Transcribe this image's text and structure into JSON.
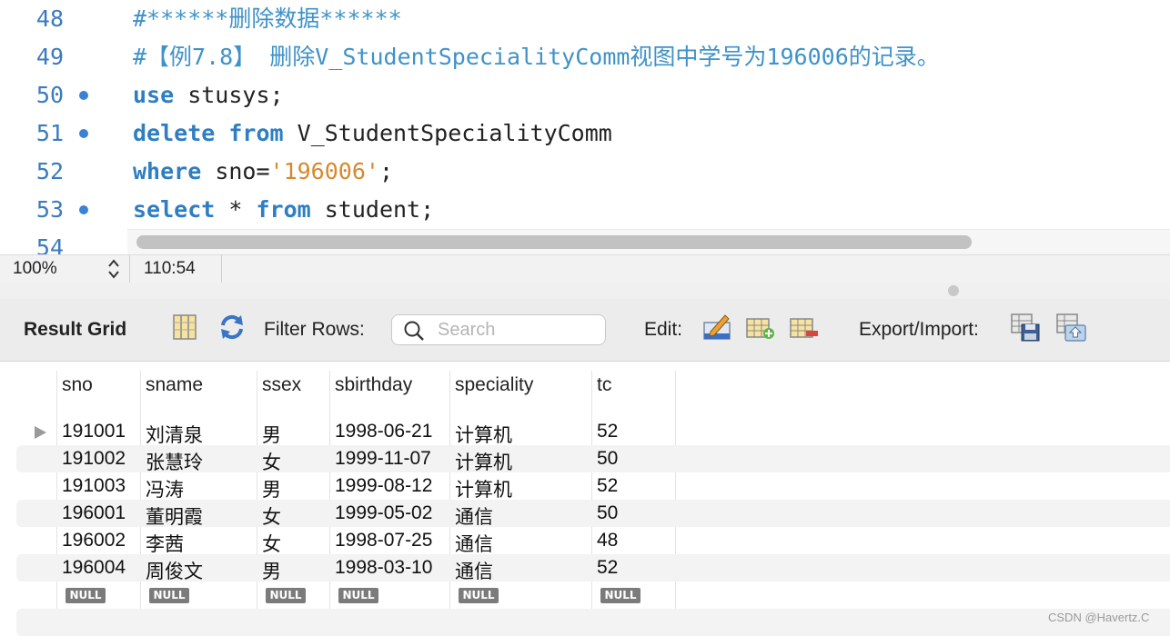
{
  "editor": {
    "lines": [
      {
        "num": "48",
        "dot": false,
        "parts": [
          {
            "t": "#******删除数据******",
            "c": "cm"
          }
        ]
      },
      {
        "num": "49",
        "dot": false,
        "parts": [
          {
            "t": "#【例7.8】 删除V_StudentSpecialityComm视图中学号为196006的记录。",
            "c": "cm"
          }
        ]
      },
      {
        "num": "50",
        "dot": true,
        "parts": [
          {
            "t": "use",
            "c": "kw"
          },
          {
            "t": " stusys;",
            "c": ""
          }
        ]
      },
      {
        "num": "51",
        "dot": true,
        "parts": [
          {
            "t": "delete",
            "c": "kw"
          },
          {
            "t": " ",
            "c": ""
          },
          {
            "t": "from",
            "c": "kw"
          },
          {
            "t": " V_StudentSpecialityComm",
            "c": ""
          }
        ]
      },
      {
        "num": "52",
        "dot": false,
        "parts": [
          {
            "t": "where",
            "c": "kw"
          },
          {
            "t": " sno=",
            "c": ""
          },
          {
            "t": "'196006'",
            "c": "str"
          },
          {
            "t": ";",
            "c": ""
          }
        ]
      },
      {
        "num": "53",
        "dot": true,
        "parts": [
          {
            "t": "select",
            "c": "kw"
          },
          {
            "t": " * ",
            "c": ""
          },
          {
            "t": "from",
            "c": "kw"
          },
          {
            "t": " student;",
            "c": ""
          }
        ]
      },
      {
        "num": "54",
        "dot": false,
        "parts": []
      }
    ]
  },
  "status": {
    "zoom": "100%",
    "cursor": "110:54"
  },
  "toolbar": {
    "title": "Result Grid",
    "filter_label": "Filter Rows:",
    "search_placeholder": "Search",
    "edit_label": "Edit:",
    "export_label": "Export/Import:"
  },
  "grid": {
    "columns": [
      "sno",
      "sname",
      "ssex",
      "sbirthday",
      "speciality",
      "tc"
    ],
    "rows": [
      [
        "191001",
        "刘清泉",
        "男",
        "1998-06-21",
        "计算机",
        "52"
      ],
      [
        "191002",
        "张慧玲",
        "女",
        "1999-11-07",
        "计算机",
        "50"
      ],
      [
        "191003",
        "冯涛",
        "男",
        "1999-08-12",
        "计算机",
        "52"
      ],
      [
        "196001",
        "董明霞",
        "女",
        "1999-05-02",
        "通信",
        "50"
      ],
      [
        "196002",
        "李茜",
        "女",
        "1998-07-25",
        "通信",
        "48"
      ],
      [
        "196004",
        "周俊文",
        "男",
        "1998-03-10",
        "通信",
        "52"
      ]
    ],
    "null_label": "NULL"
  },
  "watermark": "CSDN @Havertz.C"
}
